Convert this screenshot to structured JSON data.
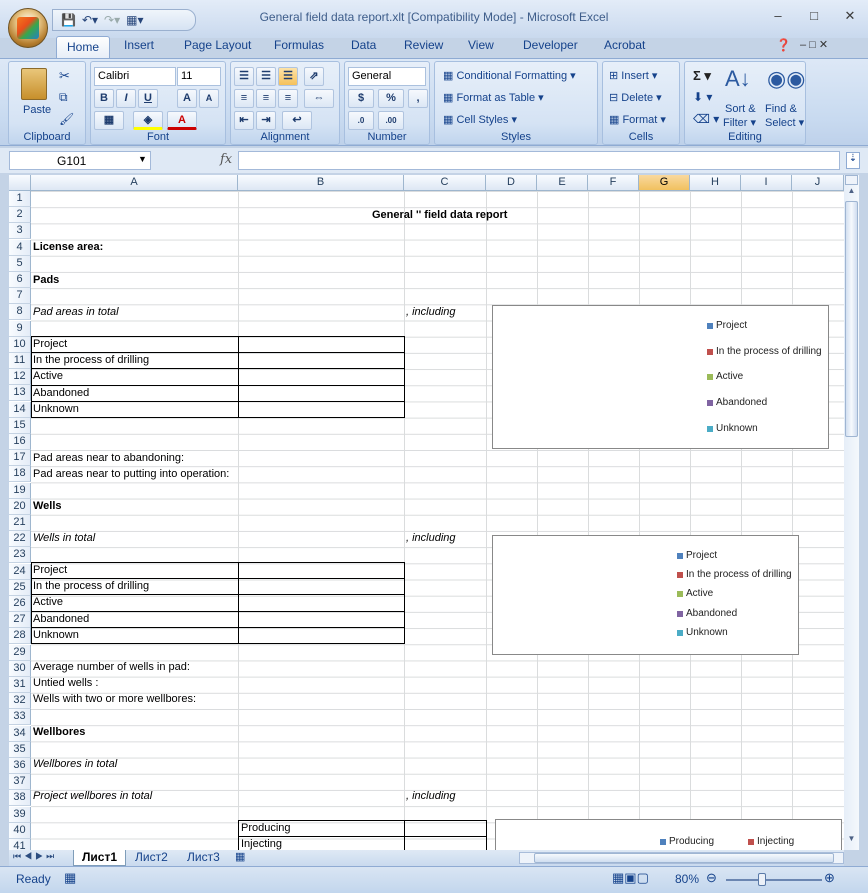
{
  "window": {
    "title": "General field data report.xlt  [Compatibility Mode] - Microsoft Excel"
  },
  "tabs": [
    "Home",
    "Insert",
    "Page Layout",
    "Formulas",
    "Data",
    "Review",
    "View",
    "Developer",
    "Acrobat"
  ],
  "ribbon": {
    "paste": "Paste",
    "font_name": "Calibri",
    "font_size": "11",
    "number_format": "General",
    "conditional_formatting": "Conditional Formatting",
    "format_as_table": "Format as Table",
    "cell_styles": "Cell Styles",
    "insert": "Insert",
    "delete": "Delete",
    "format": "Format",
    "sort_filter_1": "Sort &",
    "sort_filter_2": "Filter",
    "find_select_1": "Find &",
    "find_select_2": "Select",
    "groups": {
      "clipboard": "Clipboard",
      "font": "Font",
      "alignment": "Alignment",
      "number": "Number",
      "styles": "Styles",
      "cells": "Cells",
      "editing": "Editing"
    }
  },
  "formula_bar": {
    "name_box": "G101",
    "fx": "fx",
    "formula": ""
  },
  "columns": [
    "A",
    "B",
    "C",
    "D",
    "E",
    "F",
    "G",
    "H",
    "I",
    "J"
  ],
  "rows": [
    "1",
    "2",
    "3",
    "4",
    "5",
    "6",
    "7",
    "8",
    "9",
    "10",
    "11",
    "12",
    "13",
    "14",
    "15",
    "16",
    "17",
    "18",
    "19",
    "20",
    "21",
    "22",
    "23",
    "24",
    "25",
    "26",
    "27",
    "28",
    "29",
    "30",
    "31",
    "32",
    "33",
    "34",
    "35",
    "36",
    "37",
    "38",
    "39",
    "40",
    "41"
  ],
  "cells": {
    "r2": "General '' field data report",
    "r4": "License area:",
    "r6": "Pads",
    "r8": "Pad areas in total",
    "r8c": ", including",
    "r10": "Project",
    "r11": "In the process of drilling",
    "r12": "Active",
    "r13": "Abandoned",
    "r14": "Unknown",
    "r17": "Pad areas near to abandoning:",
    "r18": "Pad areas near to putting into operation:",
    "r20": "Wells",
    "r22": "Wells in total",
    "r22c": ", including",
    "r24": "Project",
    "r25": "In the process of drilling",
    "r26": "Active",
    "r27": "Abandoned",
    "r28": "Unknown",
    "r30": "Average number of wells in pad:",
    "r31": "Untied wells :",
    "r32": "Wells with two or more wellbores:",
    "r34": "Wellbores",
    "r36": "Wellbores in total",
    "r38": "Project wellbores in total",
    "r38c": ", including",
    "r40b": "Producing",
    "r41b": "Injecting"
  },
  "charts": {
    "chart1_legend": [
      "Project",
      "In the process of drilling",
      "Active",
      "Abandoned",
      "Unknown"
    ],
    "chart2_legend": [
      "Project",
      "In the process of drilling",
      "Active",
      "Abandoned",
      "Unknown"
    ],
    "chart3_legend": [
      "Producing",
      "Injecting"
    ],
    "colors": [
      "#4f81bd",
      "#c0504d",
      "#9bbb59",
      "#8064a2",
      "#4bacc6"
    ]
  },
  "sheets": [
    "Лист1",
    "Лист2",
    "Лист3"
  ],
  "status": {
    "ready": "Ready",
    "zoom": "80%"
  }
}
